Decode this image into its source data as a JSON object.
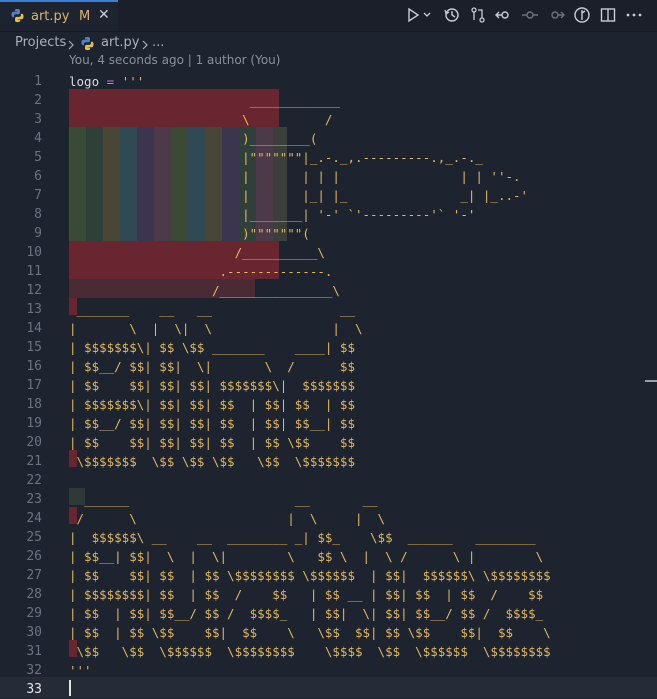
{
  "tab": {
    "title": "art.py",
    "badge": "M",
    "close": "✕"
  },
  "breadcrumb": {
    "root": "Projects",
    "file": "art.py",
    "more": "..."
  },
  "blame": "You, 4 seconds ago | 1 author (You)",
  "code_lines": [
    "logo = '''",
    "",
    "",
    "",
    "",
    "",
    "",
    "",
    "",
    "",
    "",
    "",
    " _______    __   __                 __",
    "|       \\  |  \\|  \\                |  \\",
    "| $$$$$$$\\| $$ \\$$ _______    ____| $$",
    "| $$__/ $$| $$|  \\|       \\  /      $$",
    "| $$    $$| $$| $$| $$$$$$$\\|  $$$$$$$",
    "| $$$$$$$\\| $$| $$| $$  | $$| $$  | $$",
    "| $$__/ $$| $$| $$| $$  | $$| $$__| $$",
    "| $$    $$| $$| $$| $$  | $$ \\$$    $$",
    " \\$$$$$$$  \\$$ \\$$ \\$$   \\$$  \\$$$$$$$",
    "",
    "  ______                      __       __",
    " /      \\                    |  \\     |  \\",
    "|  $$$$$$\\ __    __  ________ _| $$_    \\$$  ______   ________",
    "| $$__| $$|  \\  |  \\|        \\   $$ \\  |  \\ /      \\ |        \\",
    "| $$    $$| $$  | $$ \\$$$$$$$$ \\$$$$$$  | $$|  $$$$$$\\ \\$$$$$$$$",
    "| $$$$$$$$| $$  | $$  /    $$   | $$ __ | $$| $$  | $$  /    $$",
    "| $$  | $$| $$__/ $$ /  $$$$_   | $$|  \\| $$| $$__/ $$ /  $$$$_",
    "| $$  | $$ \\$$    $$|  $$    \\   \\$$  $$| $$ \\$$    $$|  $$    \\",
    " \\$$   \\$$  \\$$$$$$  \\$$$$$$$$    \\$$$$  \\$$  \\$$$$$$  \\$$$$$$$$",
    "'''",
    ""
  ],
  "gavel_lines": [
    "                        ____________",
    "                       \\          /",
    "                       )________(",
    "                       |\"\"\"\"\"\"\"|_.-._,.---------.,_.-._",
    "                       |       | | |                | | ''-.",
    "                       |       |_| |_               _| |_..-'",
    "                       |_______| '-' `'---------'` '-'",
    "                       )\"\"\"\"\"\"\"(",
    "                      /__________\\",
    "                    .-------------.",
    "                   /_______________\\"
  ]
}
